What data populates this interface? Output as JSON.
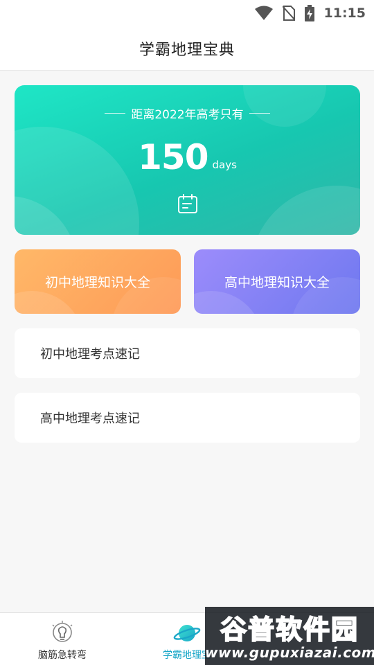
{
  "status_bar": {
    "time": "11:15",
    "icons": [
      "wifi-icon",
      "no-sim-icon",
      "battery-charging-icon"
    ]
  },
  "header": {
    "title": "学霸地理宝典"
  },
  "countdown": {
    "heading": "距离2022年高考只有",
    "number": "150",
    "unit": "days",
    "icon": "calendar-icon"
  },
  "tiles": [
    {
      "label": "初中地理知识大全"
    },
    {
      "label": "高中地理知识大全"
    }
  ],
  "list": [
    {
      "label": "初中地理考点速记"
    },
    {
      "label": "高中地理考点速记"
    }
  ],
  "bottom_nav": {
    "items": [
      {
        "label": "脑筋急转弯",
        "icon": "lightbulb-icon"
      },
      {
        "label": "学霸地理宝",
        "icon": "planet-icon",
        "active": true
      }
    ]
  },
  "watermark": {
    "title": "谷普软件园",
    "url": "www.gupuxiazai.com"
  },
  "colors": {
    "countdown_gradient_start": "#1fe6c6",
    "countdown_gradient_end": "#31b6a8",
    "tile_junior": "#fe9a57",
    "tile_senior": "#6e78ef",
    "nav_active": "#1aa7c8"
  }
}
